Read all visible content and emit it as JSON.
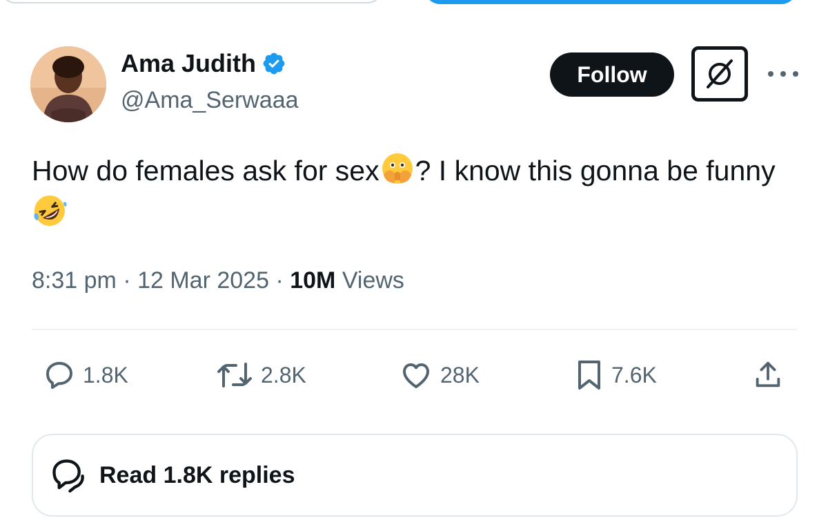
{
  "author": {
    "display_name": "Ama Judith",
    "handle": "@Ama_Serwaaa",
    "verified": true
  },
  "header": {
    "follow_label": "Follow"
  },
  "tweet": {
    "text_part1": "How do females ask for sex",
    "text_part2": "? I know this gonna be funny ",
    "emoji_1": "face-with-open-eyes-and-hand-over-mouth",
    "emoji_2": "rolling-on-the-floor-laughing"
  },
  "meta": {
    "time": "8:31 pm",
    "separator": "·",
    "date": "12 Mar 2025",
    "views_count": "10M",
    "views_label": "Views"
  },
  "actions": {
    "replies": "1.8K",
    "reposts": "2.8K",
    "likes": "28K",
    "bookmarks": "7.6K"
  },
  "read_replies": {
    "label": "Read 1.8K replies"
  },
  "colors": {
    "text_primary": "#0f1419",
    "text_secondary": "#536471",
    "accent_blue": "#1d9bf0",
    "border": "#cfd9de"
  }
}
